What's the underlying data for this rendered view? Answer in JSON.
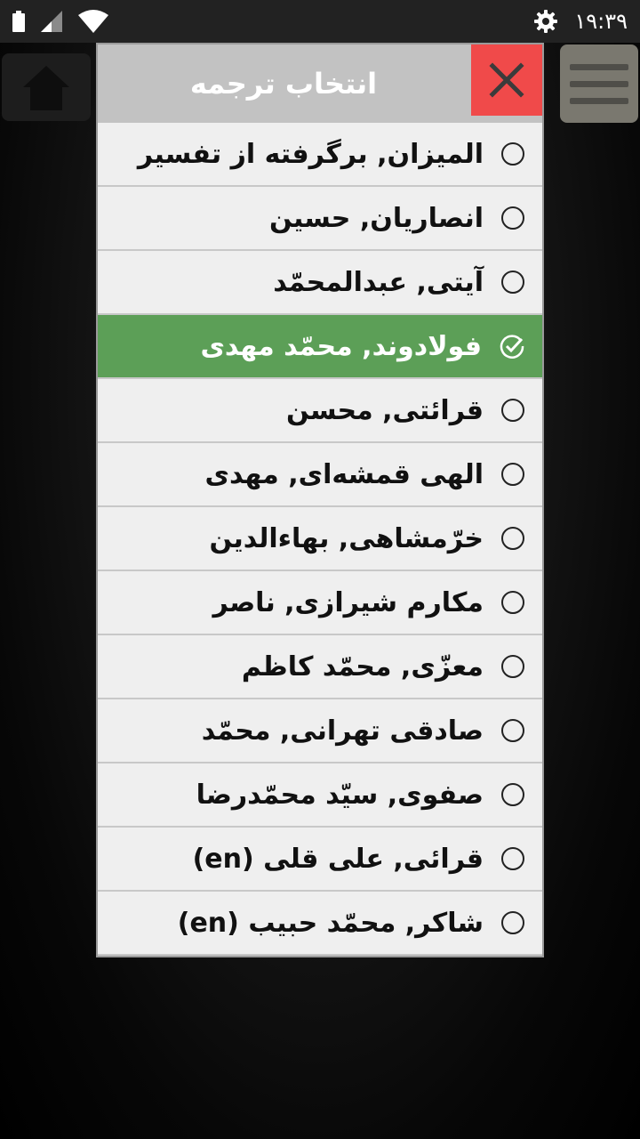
{
  "status_bar": {
    "time": "۱۹:۳۹",
    "icons": [
      "battery-icon",
      "signal-icon",
      "wifi-icon",
      "settings-icon"
    ]
  },
  "dialog": {
    "title": "انتخاب ترجمه",
    "close_icon": "close-icon",
    "close_color": "#f04a4a",
    "selected_color": "#5c9f57",
    "items": [
      {
        "label": "المیزان, برگرفته از تفسیر",
        "selected": false
      },
      {
        "label": "انصاریان, حسین",
        "selected": false
      },
      {
        "label": "آیتی, عبدالمحمّد",
        "selected": false
      },
      {
        "label": "فولادوند, محمّد مهدی",
        "selected": true
      },
      {
        "label": "قرائتی, محسن",
        "selected": false
      },
      {
        "label": "الهی قمشه‌ای, مهدی",
        "selected": false
      },
      {
        "label": "خرّمشاهی, بهاءالدین",
        "selected": false
      },
      {
        "label": "مکارم شیرازی, ناصر",
        "selected": false
      },
      {
        "label": "معزّی, محمّد کاظم",
        "selected": false
      },
      {
        "label": "صادقی تهرانی, محمّد",
        "selected": false
      },
      {
        "label": "صفوی, سیّد محمّدرضا",
        "selected": false
      },
      {
        "label": "قرائی, علی قلی (en)",
        "selected": false
      },
      {
        "label": "شاکر, محمّد حبیب (en)",
        "selected": false
      }
    ]
  },
  "background": {
    "home_icon": "home-icon",
    "menu_icon": "hamburger-menu-icon"
  }
}
